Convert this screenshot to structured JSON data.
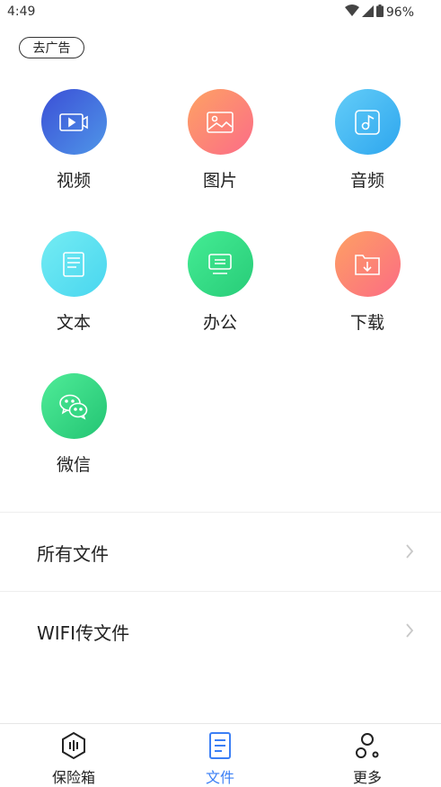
{
  "status": {
    "time": "4:49",
    "battery": "96%"
  },
  "ad_label": "去广告",
  "categories": [
    {
      "label": "视频",
      "icon": "video-icon",
      "colors": [
        "#3d57d8",
        "#4d8de6"
      ]
    },
    {
      "label": "图片",
      "icon": "image-icon",
      "colors": [
        "#fd9a66",
        "#fc6f85"
      ]
    },
    {
      "label": "音频",
      "icon": "music-icon",
      "colors": [
        "#5cc7f7",
        "#33a9f0"
      ]
    },
    {
      "label": "文本",
      "icon": "document-icon",
      "colors": [
        "#6ee9f2",
        "#4cd8f0"
      ]
    },
    {
      "label": "办公",
      "icon": "monitor-icon",
      "colors": [
        "#3ce890",
        "#2cd17a"
      ]
    },
    {
      "label": "下载",
      "icon": "download-folder-icon",
      "colors": [
        "#fc9a66",
        "#fc6f80"
      ]
    },
    {
      "label": "微信",
      "icon": "wechat-icon",
      "colors": [
        "#45e893",
        "#26c776"
      ]
    }
  ],
  "list": [
    {
      "label": "所有文件"
    },
    {
      "label": "WIFI传文件"
    }
  ],
  "tabs": [
    {
      "label": "保险箱",
      "icon": "vault-icon"
    },
    {
      "label": "文件",
      "icon": "file-icon"
    },
    {
      "label": "更多",
      "icon": "more-icon"
    }
  ],
  "accent_color": "#3b7ff5"
}
